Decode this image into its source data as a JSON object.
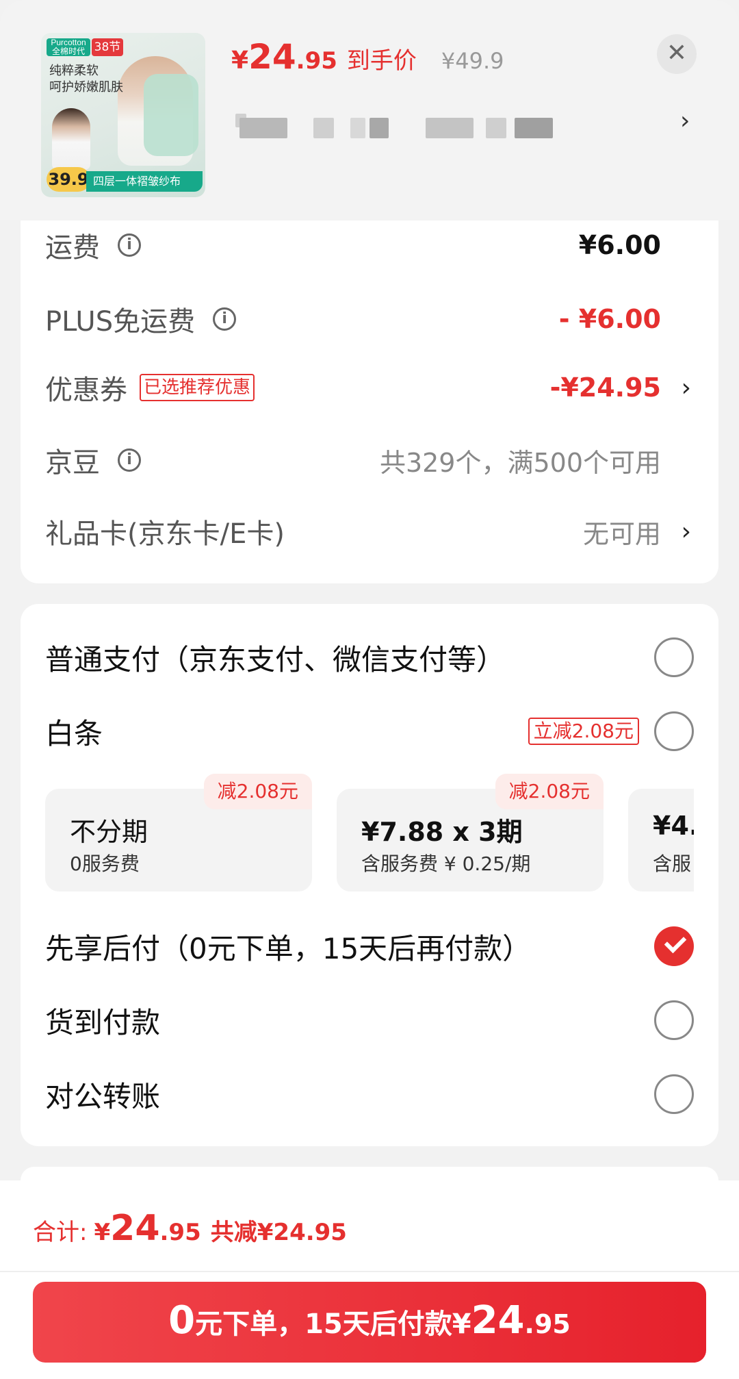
{
  "header": {
    "thumb": {
      "brand": "Purcotton 全棉时代",
      "festival": "38节",
      "slogan_1": "纯粹柔软",
      "slogan_2": "呵护娇嫩肌肤",
      "badge_price": "39.9",
      "strip": "四层一体褶皱纱布"
    },
    "price_currency": "¥",
    "price_int": "24",
    "price_dec": ".95",
    "price_tag": "到手价",
    "original_price": "¥49.9",
    "close_glyph": "✕",
    "chevron": "›"
  },
  "fees": {
    "shipping_label": "运费",
    "shipping_value": "¥6.00",
    "plus_label": "PLUS免运费",
    "plus_value": "- ¥6.00",
    "coupon_label": "优惠券",
    "coupon_badge": "已选推荐优惠",
    "coupon_value": "-¥24.95",
    "jd_bean_label": "京豆",
    "jd_bean_value": "共329个，满500个可用",
    "gift_card_label": "礼品卡(京东卡/E卡)",
    "gift_card_value": "无可用",
    "chevron": "›",
    "info_glyph": "i"
  },
  "payment": {
    "normal_label": "普通支付（京东支付、微信支付等）",
    "baitiao_label": "白条",
    "baitiao_badge": "立减2.08元",
    "plans": [
      {
        "title": "不分期",
        "sub": "0服务费",
        "discount": "减2.08元"
      },
      {
        "title": "¥7.88 x 3期",
        "sub": "含服务费 ¥ 0.25/期",
        "discount": "减2.08元"
      },
      {
        "title": "¥4.",
        "sub": "含服"
      }
    ],
    "bnpl_label": "先享后付（0元下单，15天后再付款）",
    "cod_label": "货到付款",
    "transfer_label": "对公转账"
  },
  "bottom": {
    "total_label": "合计:",
    "total_currency": "¥",
    "total_int": "24",
    "total_dec": ".95",
    "total_saved": "共减¥24.95",
    "cta_a": "0",
    "cta_b": "元下单，15天后付款¥",
    "cta_c": "24",
    "cta_d": ".95"
  },
  "colors": {
    "accent": "#e5302f",
    "brand_green": "#17a98a"
  }
}
